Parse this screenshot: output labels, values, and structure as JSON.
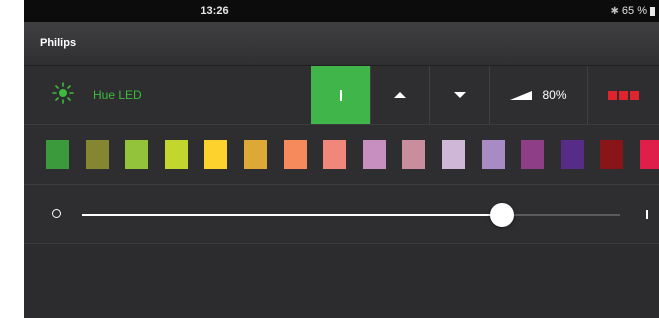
{
  "statusbar": {
    "time": "13:26",
    "battery": "65 %",
    "bluetooth_icon": "bluetooth-icon",
    "battery_icon": "battery-icon"
  },
  "nav": {
    "title": "Philips"
  },
  "light": {
    "name": "Hue LED",
    "name_color": "#3dbb3d",
    "icon": "light-bulb-icon",
    "on_button_color": "#3fb54a",
    "brightness": "80%",
    "controls": [
      "power-on-icon",
      "brightness-up-icon",
      "brightness-down-icon",
      "brightness-wedge-icon",
      "color-palette-icon"
    ]
  },
  "swatches": [
    "#3a9a3c",
    "#858631",
    "#92c33a",
    "#c2d62e",
    "#fdd22c",
    "#dea836",
    "#f68a5d",
    "#f1877a",
    "#c78fbf",
    "#c98e9e",
    "#cfb7d7",
    "#a88ac4",
    "#8d3e86",
    "#572c86",
    "#8a1518",
    "#e01e4a"
  ],
  "slider": {
    "value": 0.78
  }
}
